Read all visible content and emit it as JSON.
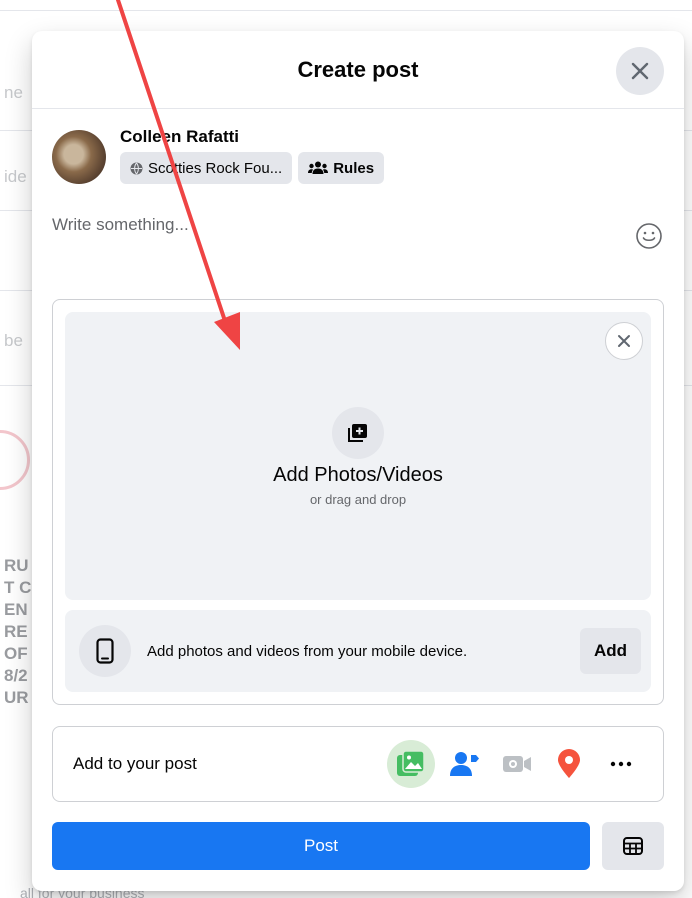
{
  "background": {
    "fragments": [
      "ne",
      "ide",
      "be",
      "RU",
      "T C",
      "EN",
      "RE",
      "OF",
      "8/2",
      "UR"
    ],
    "bottom_text": "all for your business"
  },
  "modal": {
    "title": "Create post",
    "author": {
      "name": "Colleen Rafatti",
      "audience_chip": "Scotties Rock Fou...",
      "rules_chip": "Rules"
    },
    "composer_placeholder": "Write something...",
    "media": {
      "title": "Add Photos/Videos",
      "subtitle": "or drag and drop",
      "mobile_text": "Add photos and videos from your mobile device.",
      "add_label": "Add"
    },
    "add_to_post": {
      "label": "Add to your post",
      "icons": [
        "photo-video-icon",
        "tag-people-icon",
        "live-video-icon",
        "check-in-icon",
        "more-icon"
      ]
    },
    "post_label": "Post"
  },
  "colors": {
    "primary": "#1877f2",
    "annotation_arrow": "#ef4444",
    "photo_icon": "#45bd62",
    "tag_icon": "#1877f2",
    "checkin_icon": "#f5533d"
  }
}
